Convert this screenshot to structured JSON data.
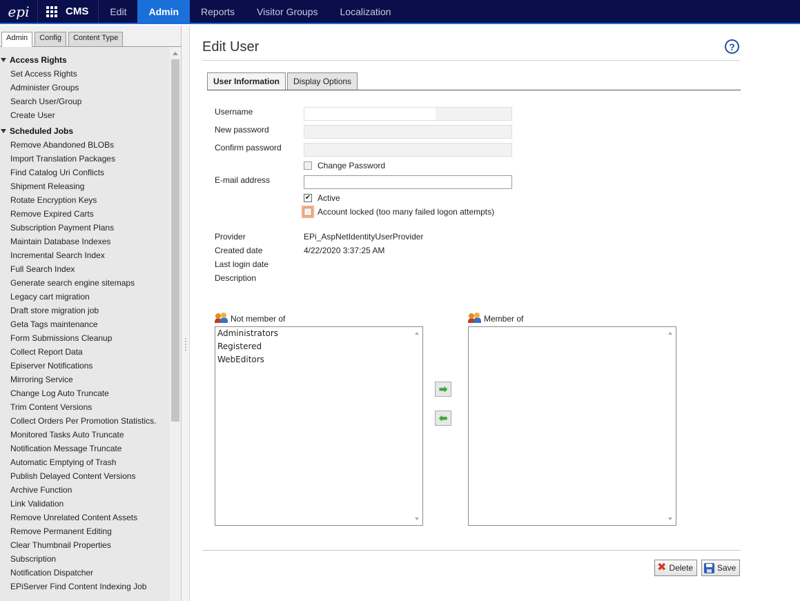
{
  "topbar": {
    "logo": "epi",
    "brand": "CMS",
    "nav": [
      "Edit",
      "Admin",
      "Reports",
      "Visitor Groups",
      "Localization"
    ],
    "active_nav": "Admin"
  },
  "sidebar": {
    "tabs": [
      "Admin",
      "Config",
      "Content Type"
    ],
    "groups": [
      {
        "title": "Access Rights",
        "items": [
          "Set Access Rights",
          "Administer Groups",
          "Search User/Group",
          "Create User"
        ]
      },
      {
        "title": "Scheduled Jobs",
        "items": [
          "Remove Abandoned BLOBs",
          "Import Translation Packages",
          "Find Catalog Uri Conflicts",
          "Shipment Releasing",
          "Rotate Encryption Keys",
          "Remove Expired Carts",
          "Subscription Payment Plans",
          "Maintain Database Indexes",
          "Incremental Search Index",
          "Full Search Index",
          "Generate search engine sitemaps",
          "Legacy cart migration",
          "Draft store migration job",
          "Geta Tags maintenance",
          "Form Submissions Cleanup",
          "Collect Report Data",
          "Episerver Notifications",
          "Mirroring Service",
          "Change Log Auto Truncate",
          "Trim Content Versions",
          "Collect Orders Per Promotion Statistics.",
          "Monitored Tasks Auto Truncate",
          "Notification Message Truncate",
          "Automatic Emptying of Trash",
          "Publish Delayed Content Versions",
          "Archive Function",
          "Link Validation",
          "Remove Unrelated Content Assets",
          "Remove Permanent Editing",
          "Clear Thumbnail Properties",
          "Subscription",
          "Notification Dispatcher",
          "EPiServer Find Content Indexing Job"
        ]
      }
    ]
  },
  "main": {
    "title": "Edit User",
    "help_label": "?",
    "tabs": [
      "User Information",
      "Display Options"
    ],
    "fields": {
      "username_label": "Username",
      "username_value": "",
      "new_password_label": "New password",
      "confirm_password_label": "Confirm password",
      "change_password_label": "Change Password",
      "email_label": "E-mail address",
      "email_value": "",
      "active_label": "Active",
      "locked_label": "Account locked (too many failed logon attempts)"
    },
    "info": [
      {
        "label": "Provider",
        "value": "EPi_AspNetIdentityUserProvider"
      },
      {
        "label": "Created date",
        "value": "4/22/2020 3:37:25 AM"
      },
      {
        "label": "Last login date",
        "value": ""
      },
      {
        "label": "Description",
        "value": ""
      }
    ],
    "not_member": {
      "label": "Not member of",
      "items": [
        "Administrators",
        "Registered",
        "WebEditors"
      ]
    },
    "member": {
      "label": "Member of",
      "items": []
    },
    "buttons": {
      "delete": "Delete",
      "save": "Save"
    }
  }
}
